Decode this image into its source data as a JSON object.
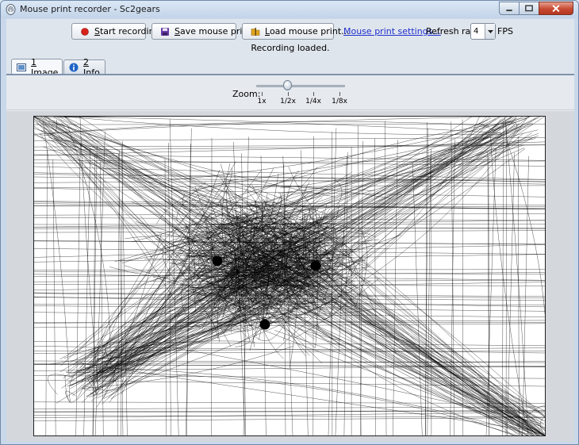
{
  "window": {
    "title": "Mouse print recorder - Sc2gears",
    "minimize_icon": "minimize-icon",
    "maximize_icon": "maximize-icon",
    "close_icon": "close-icon"
  },
  "toolbar": {
    "start_recording": {
      "key": "S",
      "rest": "tart recording",
      "icon": "record-icon",
      "icon_color": "#d8211b"
    },
    "save_mouse_print": {
      "key": "S",
      "rest": "ave mouse print",
      "icon": "floppy-disk-icon",
      "icon_color": "#6a3aa5"
    },
    "load_mouse_print": {
      "key": "L",
      "rest": "oad mouse print...",
      "icon": "folder-icon",
      "icon_color": "#e0a522"
    },
    "settings_link": "Mouse print settings...",
    "refresh_rate_label": "Refresh rate:",
    "refresh_rate_value": "4",
    "fps_label": "FPS"
  },
  "status": "Recording loaded.",
  "tabs": [
    {
      "key": "1",
      "label": " Image",
      "icon": "image-icon",
      "selected": true
    },
    {
      "key": "2",
      "label": " Info",
      "icon": "info-icon",
      "selected": false
    }
  ],
  "zoom": {
    "label": "Zoom:",
    "ticks": [
      "1x",
      "1/2x",
      "1/4x",
      "1/8x"
    ],
    "selected": "1/2x"
  },
  "mouse_print": {
    "description_icon": "mouse-trail-canvas",
    "click_points": 3
  },
  "colors": {
    "accent_link": "#1f2fcf",
    "record_red": "#d8211b"
  }
}
